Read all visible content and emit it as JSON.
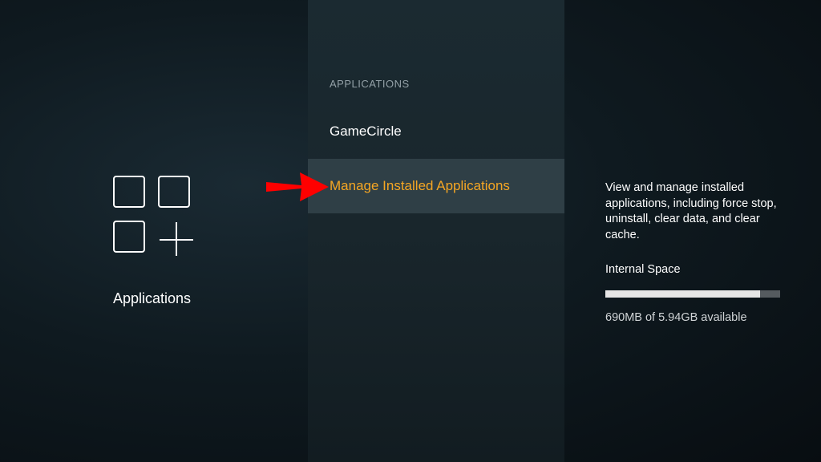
{
  "left_panel": {
    "title": "Applications",
    "icon": "apps-grid-plus-icon"
  },
  "middle_panel": {
    "section_header": "APPLICATIONS",
    "items": [
      {
        "label": "GameCircle",
        "selected": false
      },
      {
        "label": "Manage Installed Applications",
        "selected": true
      }
    ],
    "selected_color": "#f5a623"
  },
  "right_panel": {
    "description": "View and manage installed applications, including force stop, uninstall, clear data, and clear cache.",
    "storage": {
      "label": "Internal Space",
      "used_fraction": 0.886,
      "available_text": "690MB of 5.94GB available"
    }
  },
  "annotation": {
    "arrow_color": "#ff0000",
    "icon": "red-arrow-icon"
  }
}
